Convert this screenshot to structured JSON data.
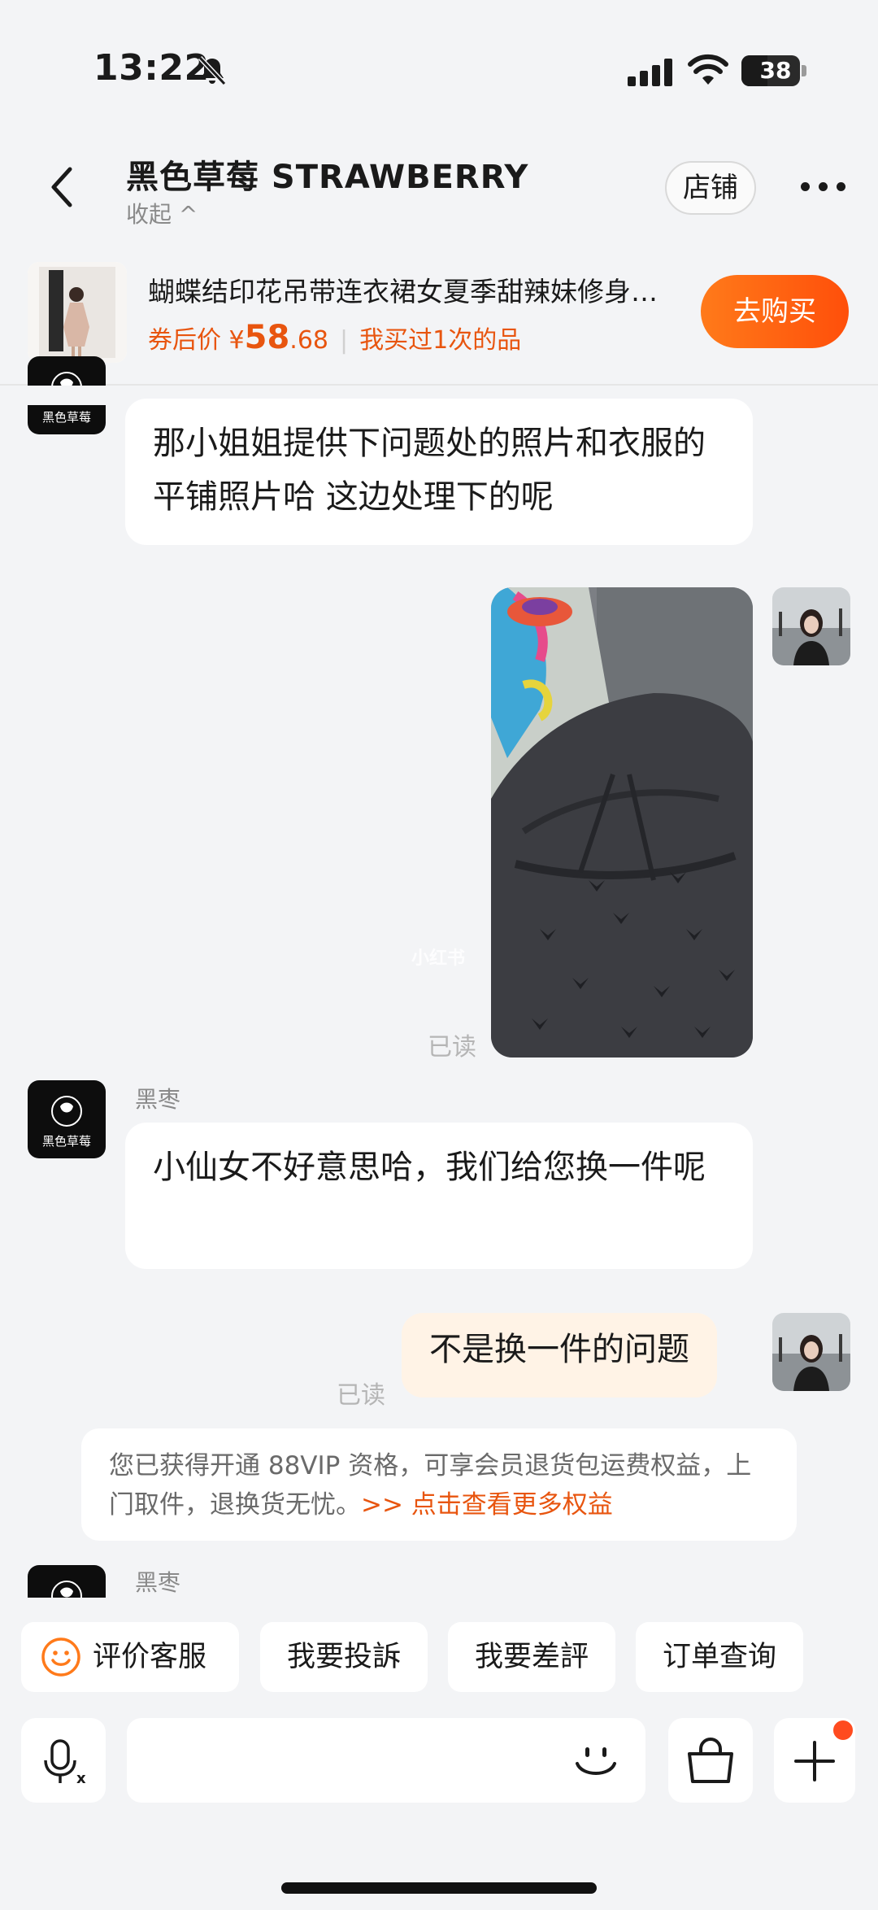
{
  "status": {
    "time": "13:22",
    "battery": "38"
  },
  "header": {
    "shop_name": "黑色草莓 STRAWBERRY",
    "collapse": "收起 ^",
    "store_button": "店铺"
  },
  "product": {
    "title": "蝴蝶结印花吊带连衣裙女夏季甜辣妹修身…",
    "price_label": "券后价 ¥",
    "price_int": "58",
    "price_dec": ".68",
    "bought": "我买过1次的品",
    "buy_button": "去购买"
  },
  "chat": {
    "messages": [
      {
        "from": "shop",
        "text": "那小姐姐提供下问题处的照片和衣服的平铺照片哈 这边处理下的呢"
      },
      {
        "from": "me",
        "type": "image",
        "read": "已读"
      },
      {
        "from": "shop",
        "sender": "黑枣",
        "text": "小仙女不好意思哈，我们给您换一件呢"
      },
      {
        "from": "me",
        "text": "不是换一件的问题",
        "read": "已读"
      },
      {
        "from": "shop",
        "sender": "黑枣"
      }
    ],
    "notice_text": "您已获得开通 88VIP 资格，可享会员退货包运费权益，上门取件，退换货无忧。",
    "notice_link": ">> 点击查看更多权益",
    "avatar_logo_text": "黑色草莓",
    "watermark": "小红书"
  },
  "quick_actions": [
    "评价客服",
    "我要投訴",
    "我要差評",
    "订单查询"
  ],
  "colors": {
    "accent": "#ff5a10",
    "price": "#e8550f",
    "mine_bubble": "#fff3e6",
    "background": "#f3f4f6"
  }
}
